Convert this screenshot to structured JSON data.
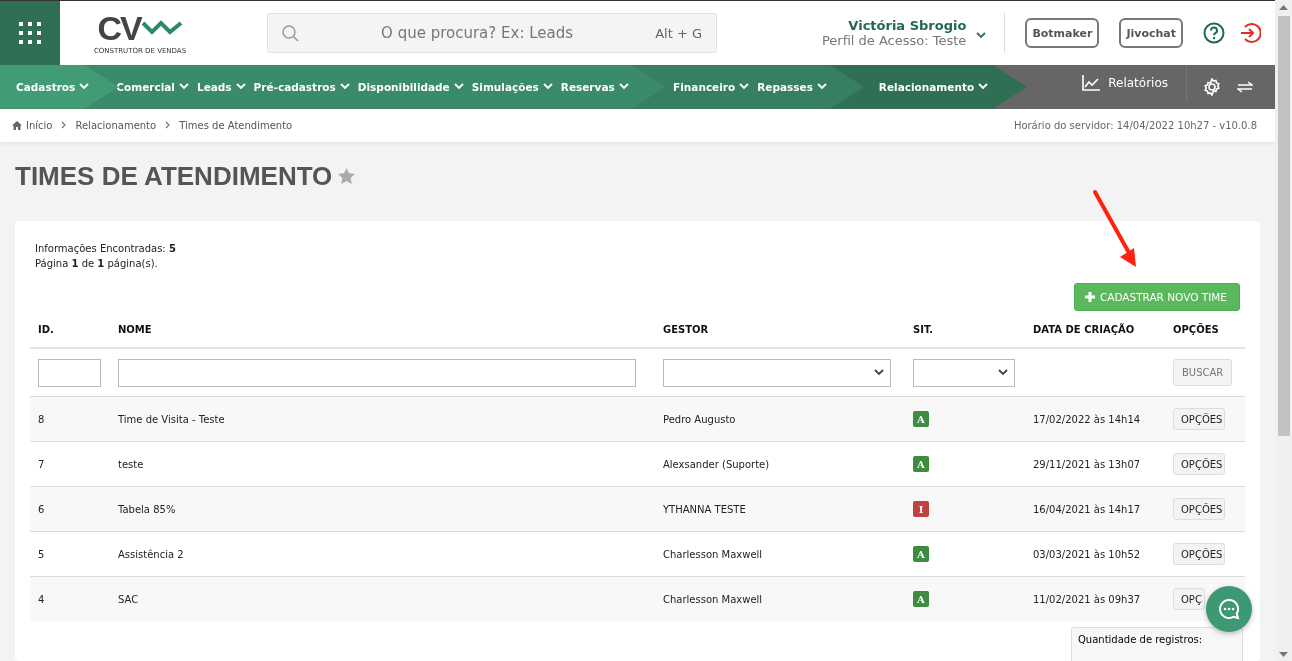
{
  "header": {
    "logo": {
      "text": "CV",
      "tagline": "CONSTRUTOR DE VENDAS"
    },
    "search": {
      "placeholder": "O que procura? Ex: Leads",
      "shortcut": "Alt + G"
    },
    "user": {
      "name": "Victória Sbrogio",
      "profile": "Perfil de Acesso: Teste"
    },
    "buttons": [
      "Botmaker",
      "Jivochat"
    ]
  },
  "nav": {
    "segments": [
      {
        "color": "#419c76",
        "items": [
          "Cadastros"
        ]
      },
      {
        "color": "#3a8b69",
        "items": [
          "Comercial",
          "Leads",
          "Pré-cadastros",
          "Disponibilidade",
          "Simulações",
          "Reservas"
        ]
      },
      {
        "color": "#367f60",
        "items": [
          "Financeiro",
          "Repasses"
        ]
      },
      {
        "color": "#2f7055",
        "items": [
          "Relacionamento"
        ]
      }
    ],
    "reports": "Relatórios"
  },
  "breadcrumb": [
    "Início",
    "Relacionamento",
    "Times de Atendimento"
  ],
  "server_time": "Horário do servidor: 14/04/2022 10h27 - v10.0.8",
  "page_title": "TIMES DE ATENDIMENTO",
  "info": [
    "Informações Encontradas: **5**",
    "Página **1** de **1** página(s)."
  ],
  "new_button": "CADASTRAR NOVO TIME",
  "table": {
    "columns": [
      "ID.",
      "NOME",
      "GESTOR",
      "SIT.",
      "DATA DE CRIAÇÃO",
      "OPÇÕES"
    ],
    "search_button": "BUSCAR",
    "rows": [
      {
        "id": "8",
        "name": "Time de Visita - Teste",
        "manager": "Pedro Augusto",
        "status": "A",
        "color": "#3d8c40",
        "created": "17/02/2022 às 14h14",
        "action": "OPÇÕES"
      },
      {
        "id": "7",
        "name": "teste",
        "manager": "Alexsander (Suporte)",
        "status": "A",
        "color": "#3d8c40",
        "created": "29/11/2021 às 13h07",
        "action": "OPÇÕES"
      },
      {
        "id": "6",
        "name": "Tabela 85%",
        "manager": "YTHANNA TESTE",
        "status": "I",
        "color": "#c0413d",
        "created": "16/04/2021 às 14h17",
        "action": "OPÇÕES"
      },
      {
        "id": "5",
        "name": "Assistência 2",
        "manager": "Charlesson Maxwell",
        "status": "A",
        "color": "#3d8c40",
        "created": "03/03/2021 às 10h52",
        "action": "OPÇÕES"
      },
      {
        "id": "4",
        "name": "SAC",
        "manager": "Charlesson Maxwell",
        "status": "A",
        "color": "#3d8c40",
        "created": "11/02/2021 às 09h37",
        "action": "OPÇ"
      }
    ]
  },
  "records_label": "Quantidade de registros:"
}
